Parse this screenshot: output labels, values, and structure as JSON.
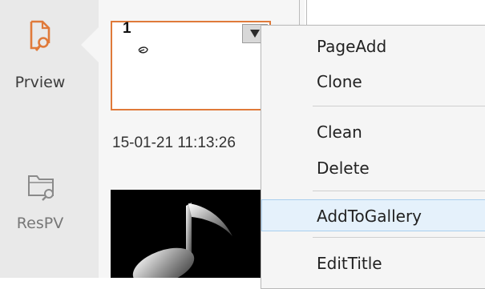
{
  "sidebar": {
    "items": [
      {
        "label": "Prview",
        "icon": "preview-doc-search-icon",
        "active": true
      },
      {
        "label": "ResPV",
        "icon": "folder-search-icon",
        "active": false
      }
    ]
  },
  "thumbnail": {
    "page_number": "1",
    "timestamp": "15-01-21 11:13:26",
    "dropdown_icon": "triangle-down-icon",
    "accent_color": "#e07a3a"
  },
  "context_menu": {
    "items": [
      {
        "label": "PageAdd"
      },
      {
        "label": "Clone"
      },
      {
        "label": "Clean"
      },
      {
        "label": "Delete"
      },
      {
        "label": "AddToGallery",
        "highlighted": true
      },
      {
        "label": "EditTitle"
      }
    ]
  }
}
